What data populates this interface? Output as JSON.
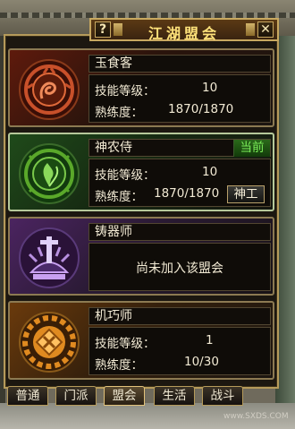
{
  "window": {
    "title": "江湖盟会",
    "help_label": "?",
    "close_label": "✕"
  },
  "labels": {
    "skill_level": "技能等级：",
    "proficiency": "熟练度："
  },
  "guilds": [
    {
      "name": "玉食客",
      "emblem": "dragon-emblem-icon",
      "color": "#c8502a",
      "skill_level": "10",
      "proficiency": "1870/1870"
    },
    {
      "name": "神农侍",
      "emblem": "herb-emblem-icon",
      "color": "#5aa82a",
      "skill_level": "10",
      "proficiency": "1870/1870",
      "status": "当前",
      "action_label": "神工"
    },
    {
      "name": "铸器师",
      "emblem": "forge-emblem-icon",
      "color": "#9a5ad0",
      "message": "尚未加入该盟会"
    },
    {
      "name": "机巧师",
      "emblem": "gear-emblem-icon",
      "color": "#e08a20",
      "skill_level": "1",
      "proficiency": "10/30"
    }
  ],
  "tabs": [
    {
      "label": "普通",
      "active": false
    },
    {
      "label": "门派",
      "active": false
    },
    {
      "label": "盟会",
      "active": true
    },
    {
      "label": "生活",
      "active": false
    },
    {
      "label": "战斗",
      "active": false
    }
  ],
  "watermark": "www.SXDS.COM"
}
